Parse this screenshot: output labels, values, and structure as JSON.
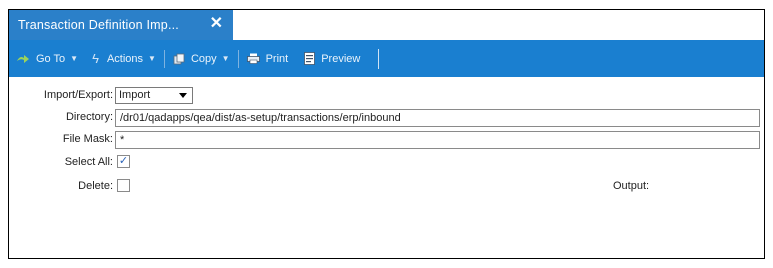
{
  "tab": {
    "title": "Transaction Definition Imp...",
    "close_icon": "close-icon"
  },
  "toolbar": {
    "goto_label": "Go To",
    "actions_label": "Actions",
    "copy_label": "Copy",
    "print_label": "Print",
    "preview_label": "Preview"
  },
  "form": {
    "import_export_label": "Import/Export:",
    "import_export_value": "Import",
    "directory_label": "Directory:",
    "directory_value": "/dr01/qadapps/qea/dist/as-setup/transactions/erp/inbound",
    "file_mask_label": "File Mask:",
    "file_mask_value": "*",
    "select_all_label": "Select All:",
    "select_all_checked": true,
    "delete_label": "Delete:",
    "delete_checked": false,
    "output_label": "Output:"
  },
  "colors": {
    "tab": "#2b80c9",
    "toolbar": "#1a7fd0"
  }
}
